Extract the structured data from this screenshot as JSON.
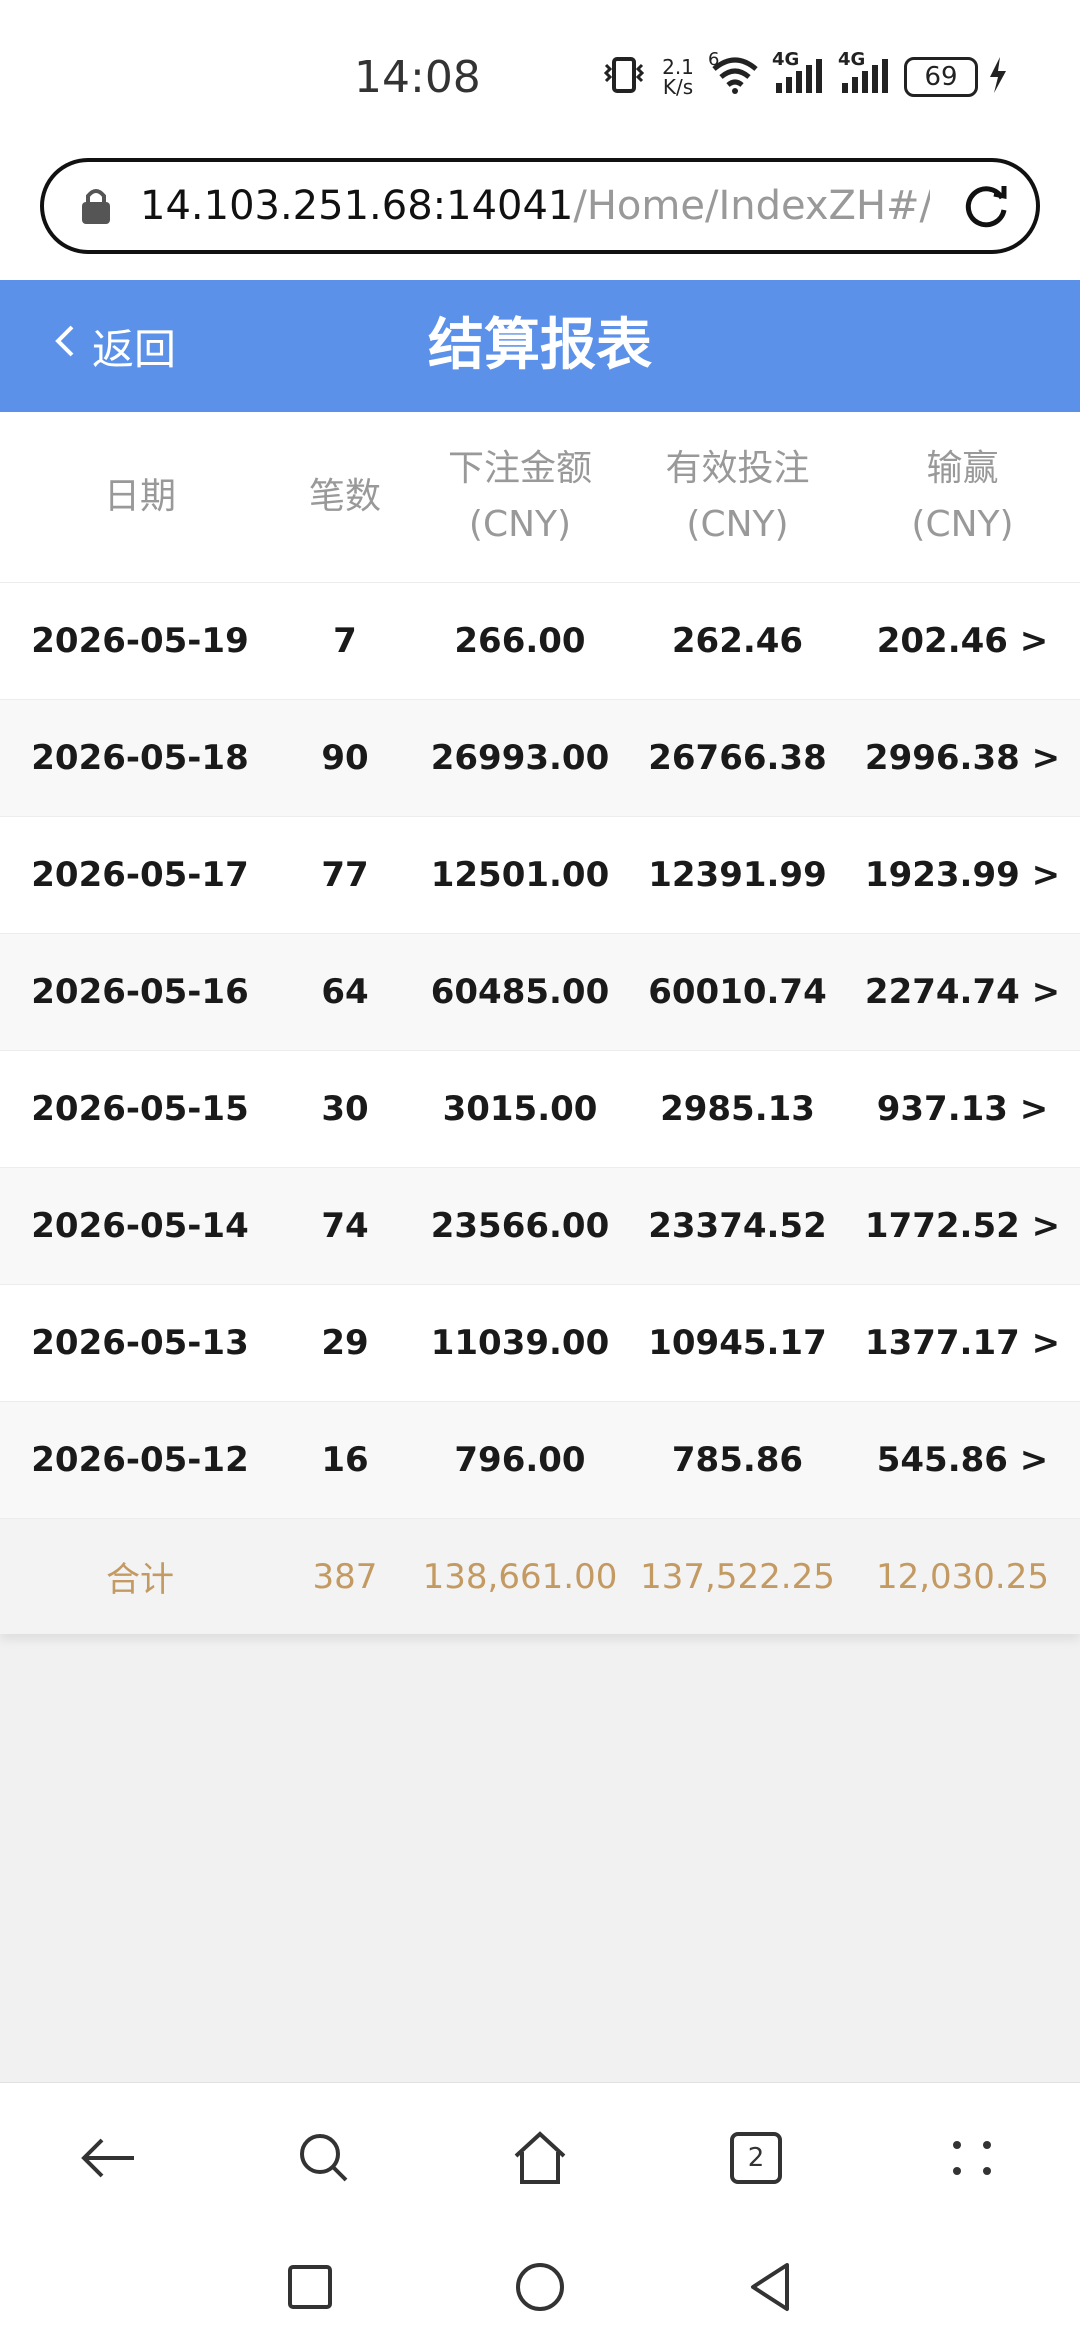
{
  "status": {
    "time": "14:08",
    "net_speed_value": "2.1",
    "net_speed_unit": "K/s",
    "wifi_badge": "6",
    "signal1_label": "4G",
    "signal2_label": "4G",
    "battery": "69"
  },
  "browser": {
    "url_host": "14.103.251.68:14041",
    "url_path": "/Home/IndexZH#/sett"
  },
  "header": {
    "back_label": "返回",
    "title": "结算报表"
  },
  "table": {
    "columns": [
      {
        "label": "日期",
        "unit": ""
      },
      {
        "label": "笔数",
        "unit": ""
      },
      {
        "label": "下注金额",
        "unit": "(CNY)"
      },
      {
        "label": "有效投注",
        "unit": "(CNY)"
      },
      {
        "label": "输赢",
        "unit": "(CNY)"
      }
    ],
    "rows": [
      {
        "date": "2026-05-19",
        "count": "7",
        "bet": "266.00",
        "valid": "262.46",
        "win": "202.46 >"
      },
      {
        "date": "2026-05-18",
        "count": "90",
        "bet": "26993.00",
        "valid": "26766.38",
        "win": "2996.38 >"
      },
      {
        "date": "2026-05-17",
        "count": "77",
        "bet": "12501.00",
        "valid": "12391.99",
        "win": "1923.99 >"
      },
      {
        "date": "2026-05-16",
        "count": "64",
        "bet": "60485.00",
        "valid": "60010.74",
        "win": "2274.74 >"
      },
      {
        "date": "2026-05-15",
        "count": "30",
        "bet": "3015.00",
        "valid": "2985.13",
        "win": "937.13 >"
      },
      {
        "date": "2026-05-14",
        "count": "74",
        "bet": "23566.00",
        "valid": "23374.52",
        "win": "1772.52 >"
      },
      {
        "date": "2026-05-13",
        "count": "29",
        "bet": "11039.00",
        "valid": "10945.17",
        "win": "1377.17 >"
      },
      {
        "date": "2026-05-12",
        "count": "16",
        "bet": "796.00",
        "valid": "785.86",
        "win": "545.86 >"
      }
    ],
    "total": {
      "label": "合计",
      "count": "387",
      "bet": "138,661.00",
      "valid": "137,522.25",
      "win": "12,030.25"
    }
  },
  "nav": {
    "tab_count": "2"
  },
  "colors": {
    "header_bg": "#5b91e8",
    "total_text": "#c49a63"
  }
}
